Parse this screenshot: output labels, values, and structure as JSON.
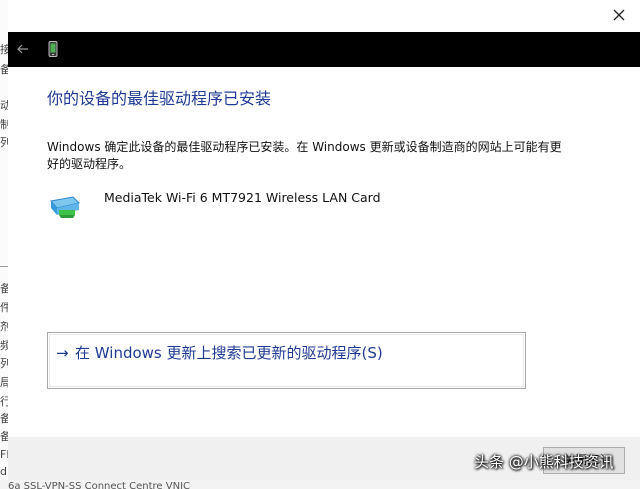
{
  "background_window": {
    "left_glyphs": [
      "接",
      "备",
      "动",
      "制",
      "列",
      "备",
      "件",
      "剂",
      "频",
      "列",
      "局",
      "行",
      "备",
      "备",
      "FI",
      "d",
      "属"
    ],
    "bottom_text": "6a SSL-VPN-SS Connect Centre VNIC"
  },
  "dialog": {
    "close_icon": "close-icon",
    "back_icon": "back-arrow-icon",
    "device_icon": "mobile-device-icon",
    "heading": "你的设备的最佳驱动程序已安装",
    "description": "Windows 确定此设备的最佳驱动程序已安装。在 Windows 更新或设备制造商的网站上可能有更好的驱动程序。",
    "device": {
      "icon": "network-adapter-icon",
      "name": "MediaTek Wi-Fi 6 MT7921 Wireless LAN Card"
    },
    "search_link": {
      "arrow": "→",
      "label": "在 Windows 更新上搜索已更新的驱动程序(S)"
    },
    "footer": {
      "close_button": "关闭(C)"
    }
  },
  "watermark": "头条 @小熊科技资讯",
  "colors": {
    "link_blue": "#1f3a93",
    "navbar": "#000000",
    "footer": "#f0f0f0"
  }
}
